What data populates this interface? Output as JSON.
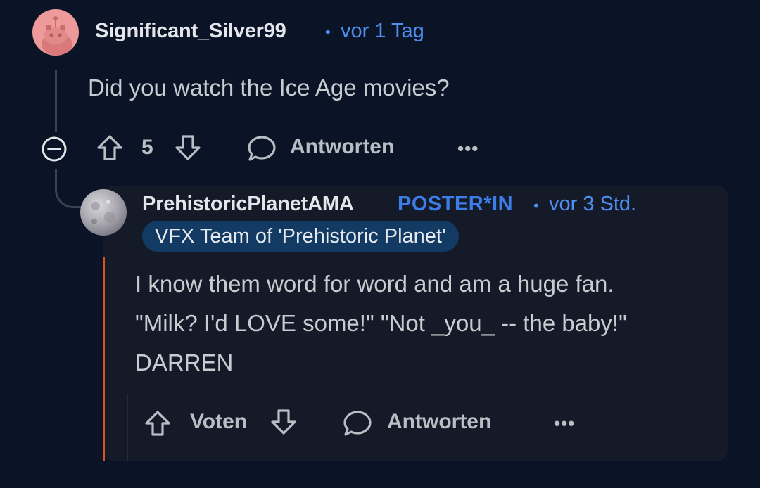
{
  "parent_comment": {
    "username": "Significant_Silver99",
    "separator": "•",
    "time": "vor 1 Tag",
    "body": "Did you watch the Ice Age movies?",
    "vote_count": "5",
    "reply_label": "Antworten",
    "more_label": "•••"
  },
  "reply_comment": {
    "username": "PrehistoricPlanetAMA",
    "poster_badge": "POSTER*IN",
    "separator": "•",
    "time": "vor 3 Std.",
    "flair": "VFX Team of 'Prehistoric Planet'",
    "body_lines": [
      "I know them word for word and am a huge fan.",
      "\"Milk? I'd LOVE some!\" \"Not _you_ -- the baby!\"",
      "DARREN"
    ],
    "vote_label": "Voten",
    "reply_label": "Antworten",
    "more_label": "•••"
  },
  "colors": {
    "background": "#0b1426",
    "link_blue": "#4f8ff0",
    "accent_orange": "#d9541e",
    "flair_bg": "#123a63"
  }
}
